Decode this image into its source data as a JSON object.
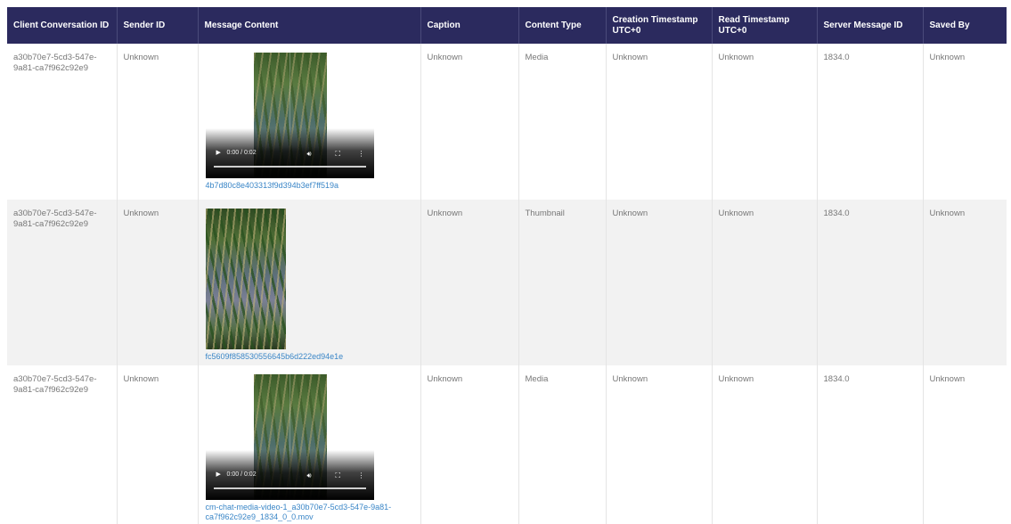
{
  "headers": {
    "client_conversation_id": "Client Conversation ID",
    "sender_id": "Sender ID",
    "message_content": "Message Content",
    "caption": "Caption",
    "content_type": "Content Type",
    "creation_timestamp": "Creation Timestamp",
    "creation_timestamp_tz": "UTC+0",
    "read_timestamp": "Read Timestamp",
    "read_timestamp_tz": "UTC+0",
    "server_message_id": "Server Message ID",
    "saved_by": "Saved By"
  },
  "rows": [
    {
      "client_conversation_id": "a30b70e7-5cd3-547e-9a81-ca7f962c92e9",
      "sender_id": "Unknown",
      "media_kind": "video",
      "media_time": "0:00 / 0:02",
      "media_link": "4b7d80c8e403313f9d394b3ef7ff519a",
      "caption": "Unknown",
      "content_type": "Media",
      "creation_timestamp": "Unknown",
      "read_timestamp": "Unknown",
      "server_message_id": "1834.0",
      "saved_by": "Unknown"
    },
    {
      "client_conversation_id": "a30b70e7-5cd3-547e-9a81-ca7f962c92e9",
      "sender_id": "Unknown",
      "media_kind": "image",
      "media_link": "fc5609f858530556645b6d222ed94e1e",
      "caption": "Unknown",
      "content_type": "Thumbnail",
      "creation_timestamp": "Unknown",
      "read_timestamp": "Unknown",
      "server_message_id": "1834.0",
      "saved_by": "Unknown"
    },
    {
      "client_conversation_id": "a30b70e7-5cd3-547e-9a81-ca7f962c92e9",
      "sender_id": "Unknown",
      "media_kind": "video",
      "media_time": "0:00 / 0:02",
      "media_link": "cm-chat-media-video-1_a30b70e7-5cd3-547e-9a81-ca7f962c92e9_1834_0_0.mov",
      "caption": "Unknown",
      "content_type": "Media",
      "creation_timestamp": "Unknown",
      "read_timestamp": "Unknown",
      "server_message_id": "1834.0",
      "saved_by": "Unknown"
    }
  ],
  "icons": {
    "play": "play-icon",
    "volume": "volume-icon",
    "fullscreen": "fullscreen-icon",
    "more": "more-options-icon"
  },
  "colors": {
    "header_bg": "#2b2a5e",
    "link": "#3a86c7",
    "alt_row": "#f2f2f2"
  }
}
